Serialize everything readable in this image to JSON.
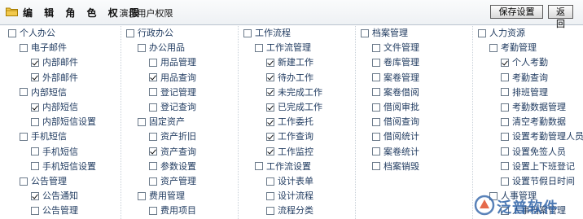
{
  "header": {
    "title": "编 辑 角 色 权 限",
    "subtitle": "- 演示用户权限",
    "save_label": "保存设置",
    "back_label": "返回"
  },
  "watermark": {
    "text": "泛普软件"
  },
  "columns": [
    {
      "items": [
        {
          "label": "个人办公",
          "checked": false,
          "level": 0
        },
        {
          "label": "电子邮件",
          "checked": false,
          "level": 1
        },
        {
          "label": "内部邮件",
          "checked": true,
          "level": 2
        },
        {
          "label": "外部邮件",
          "checked": true,
          "level": 2
        },
        {
          "label": "内部短信",
          "checked": false,
          "level": 1
        },
        {
          "label": "内部短信",
          "checked": true,
          "level": 2
        },
        {
          "label": "内部短信设置",
          "checked": false,
          "level": 2
        },
        {
          "label": "手机短信",
          "checked": false,
          "level": 1
        },
        {
          "label": "手机短信",
          "checked": false,
          "level": 2
        },
        {
          "label": "手机短信设置",
          "checked": false,
          "level": 2
        },
        {
          "label": "公告管理",
          "checked": false,
          "level": 1
        },
        {
          "label": "公告通知",
          "checked": true,
          "level": 2
        },
        {
          "label": "公告管理",
          "checked": false,
          "level": 2
        }
      ]
    },
    {
      "items": [
        {
          "label": "行政办公",
          "checked": false,
          "level": 0
        },
        {
          "label": "办公用品",
          "checked": false,
          "level": 1
        },
        {
          "label": "用品管理",
          "checked": false,
          "level": 2
        },
        {
          "label": "用品查询",
          "checked": true,
          "level": 2
        },
        {
          "label": "登记管理",
          "checked": false,
          "level": 2
        },
        {
          "label": "登记查询",
          "checked": false,
          "level": 2
        },
        {
          "label": "固定资产",
          "checked": false,
          "level": 1
        },
        {
          "label": "资产折旧",
          "checked": false,
          "level": 2
        },
        {
          "label": "资产查询",
          "checked": true,
          "level": 2
        },
        {
          "label": "参数设置",
          "checked": false,
          "level": 2
        },
        {
          "label": "资产管理",
          "checked": false,
          "level": 2
        },
        {
          "label": "费用管理",
          "checked": false,
          "level": 1
        },
        {
          "label": "费用项目",
          "checked": false,
          "level": 2
        }
      ]
    },
    {
      "items": [
        {
          "label": "工作流程",
          "checked": false,
          "level": 0
        },
        {
          "label": "工作流管理",
          "checked": false,
          "level": 1
        },
        {
          "label": "新建工作",
          "checked": true,
          "level": 2
        },
        {
          "label": "待办工作",
          "checked": true,
          "level": 2
        },
        {
          "label": "未完成工作",
          "checked": true,
          "level": 2
        },
        {
          "label": "已完成工作",
          "checked": true,
          "level": 2
        },
        {
          "label": "工作委托",
          "checked": true,
          "level": 2
        },
        {
          "label": "工作查询",
          "checked": true,
          "level": 2
        },
        {
          "label": "工作监控",
          "checked": true,
          "level": 2
        },
        {
          "label": "工作流设置",
          "checked": false,
          "level": 1
        },
        {
          "label": "设计表单",
          "checked": false,
          "level": 2
        },
        {
          "label": "设计流程",
          "checked": false,
          "level": 2
        },
        {
          "label": "流程分类",
          "checked": false,
          "level": 2
        }
      ]
    },
    {
      "items": [
        {
          "label": "档案管理",
          "checked": false,
          "level": 0
        },
        {
          "label": "文件管理",
          "checked": false,
          "level": 1
        },
        {
          "label": "卷库管理",
          "checked": false,
          "level": 1
        },
        {
          "label": "案卷管理",
          "checked": false,
          "level": 1
        },
        {
          "label": "案卷借阅",
          "checked": false,
          "level": 1
        },
        {
          "label": "借阅审批",
          "checked": false,
          "level": 1
        },
        {
          "label": "借阅查询",
          "checked": false,
          "level": 1
        },
        {
          "label": "借阅统计",
          "checked": false,
          "level": 1
        },
        {
          "label": "案卷统计",
          "checked": false,
          "level": 1
        },
        {
          "label": "档案销毁",
          "checked": false,
          "level": 1
        }
      ]
    },
    {
      "items": [
        {
          "label": "人力资源",
          "checked": false,
          "level": 0
        },
        {
          "label": "考勤管理",
          "checked": false,
          "level": 1
        },
        {
          "label": "个人考勤",
          "checked": true,
          "level": 2
        },
        {
          "label": "考勤查询",
          "checked": false,
          "level": 2
        },
        {
          "label": "排班管理",
          "checked": false,
          "level": 2
        },
        {
          "label": "考勤数据管理",
          "checked": false,
          "level": 2
        },
        {
          "label": "清空考勤数据",
          "checked": false,
          "level": 2
        },
        {
          "label": "设置考勤管理人员",
          "checked": false,
          "level": 2
        },
        {
          "label": "设置免签人员",
          "checked": false,
          "level": 2
        },
        {
          "label": "设置上下班登记",
          "checked": false,
          "level": 2
        },
        {
          "label": "设置节假日时间",
          "checked": false,
          "level": 2
        },
        {
          "label": "人事管理",
          "checked": false,
          "level": 1
        },
        {
          "label": "人事档案管理",
          "checked": false,
          "level": 2
        }
      ]
    }
  ]
}
